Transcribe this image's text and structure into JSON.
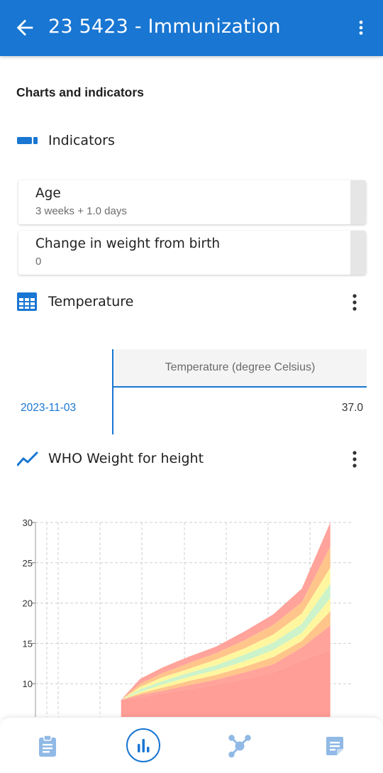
{
  "app_bar": {
    "title": "23 5423 - Immunization",
    "back_icon": "arrow-left-icon",
    "menu_icon": "more-vert-icon"
  },
  "section_title": "Charts and indicators",
  "indicators": {
    "label": "Indicators",
    "icon": "indicator-icon",
    "items": [
      {
        "name": "Age",
        "value": "3 weeks + 1.0 days"
      },
      {
        "name": "Change in weight from birth",
        "value": "0"
      }
    ]
  },
  "temperature": {
    "label": "Temperature",
    "icon": "table-icon",
    "column_header": "Temperature (degree Celsius)",
    "rows": [
      {
        "date": "2023-11-03",
        "value": "37.0"
      }
    ]
  },
  "who_chart": {
    "label": "WHO Weight for height",
    "icon": "line-chart-icon"
  },
  "chart_data": {
    "type": "area",
    "title": "",
    "xlabel": "",
    "ylabel": "",
    "yticks": [
      "30",
      "25",
      "20",
      "15",
      "10"
    ],
    "ylim": [
      5,
      30
    ],
    "x_domain": [
      0,
      100
    ],
    "grid": true,
    "x": [
      27,
      33,
      40,
      48,
      57,
      66,
      75,
      84,
      93
    ],
    "bands": [
      {
        "color": "#ff9e96",
        "lower": [
          8,
          8.3,
          8.8,
          9.3,
          9.9,
          10.6,
          11.4,
          12.9,
          14.2
        ],
        "upper": [
          8,
          8.6,
          9.1,
          9.8,
          10.5,
          11.4,
          12.4,
          14.5,
          17.2
        ]
      },
      {
        "color": "#ffc285",
        "lower": [
          8,
          8.6,
          9.1,
          9.8,
          10.5,
          11.4,
          12.4,
          14.5,
          17.2
        ],
        "upper": [
          8,
          8.8,
          9.5,
          10.3,
          11.1,
          12.1,
          13.3,
          15.3,
          19.0
        ]
      },
      {
        "color": "#fff79a",
        "lower": [
          8,
          8.8,
          9.5,
          10.3,
          11.1,
          12.1,
          13.3,
          15.3,
          19.0
        ],
        "upper": [
          8,
          9.0,
          9.9,
          10.8,
          11.7,
          12.8,
          14.2,
          16.3,
          20.6
        ]
      },
      {
        "color": "#c9f2c7",
        "lower": [
          8,
          9.0,
          9.9,
          10.8,
          11.7,
          12.8,
          14.2,
          16.3,
          20.6
        ],
        "upper": [
          8,
          9.3,
          10.3,
          11.3,
          12.3,
          13.6,
          15.1,
          17.4,
          22.4
        ]
      },
      {
        "color": "#fff79a",
        "lower": [
          8,
          9.3,
          10.3,
          11.3,
          12.3,
          13.6,
          15.1,
          17.4,
          22.4
        ],
        "upper": [
          8,
          9.6,
          10.8,
          11.8,
          13.0,
          14.4,
          16.1,
          18.7,
          24.4
        ]
      },
      {
        "color": "#ffc285",
        "lower": [
          8,
          9.6,
          10.8,
          11.8,
          13.0,
          14.4,
          16.1,
          18.7,
          24.4
        ],
        "upper": [
          8,
          10.0,
          11.3,
          12.5,
          13.8,
          15.4,
          17.3,
          20.1,
          27.0
        ]
      },
      {
        "color": "#ff9e96",
        "lower": [
          8,
          10.0,
          11.3,
          12.5,
          13.8,
          15.4,
          17.3,
          20.1,
          27.0
        ],
        "upper": [
          8,
          10.6,
          12.0,
          13.3,
          14.6,
          16.5,
          18.6,
          21.8,
          30.0
        ]
      }
    ]
  },
  "bottom_nav": {
    "items": [
      {
        "icon": "clipboard-icon",
        "active": false
      },
      {
        "icon": "bar-chart-icon",
        "active": true
      },
      {
        "icon": "relationship-icon",
        "active": false
      },
      {
        "icon": "notes-icon",
        "active": false
      }
    ]
  },
  "colors": {
    "primary": "#1976d2",
    "nav_icon": "#90b9e6"
  }
}
